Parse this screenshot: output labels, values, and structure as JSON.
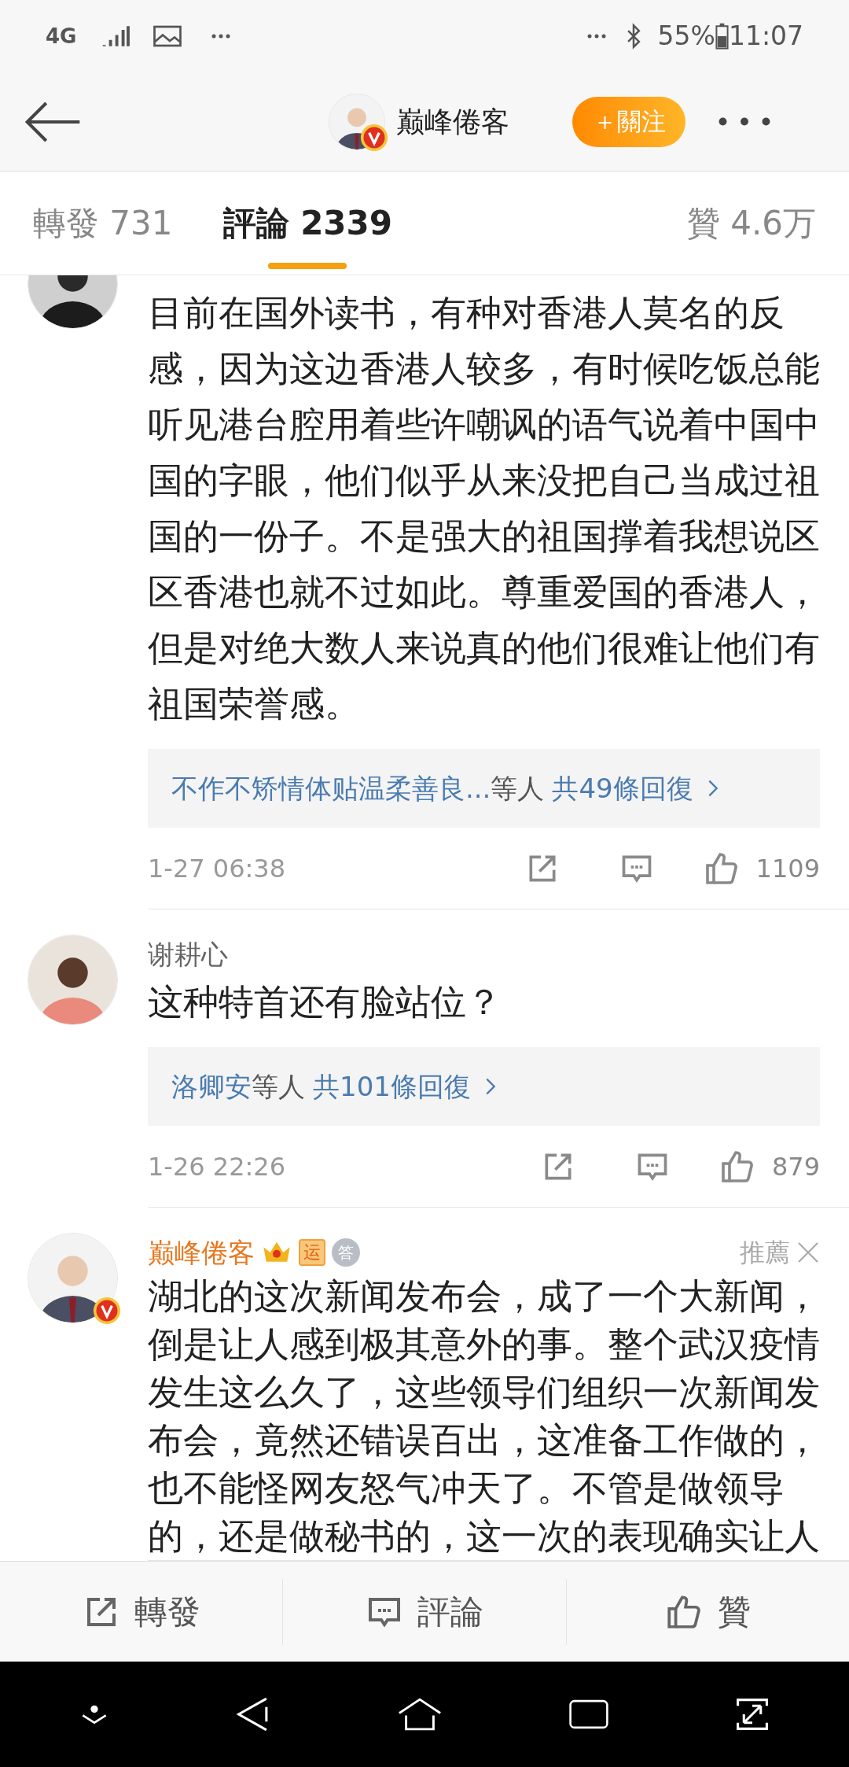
{
  "status_bar": {
    "network": "4G",
    "battery": "55%",
    "time": "11:07"
  },
  "header": {
    "name": "巅峰倦客",
    "follow": "＋關注"
  },
  "tabs": [
    {
      "label": "轉發 731",
      "selected": false
    },
    {
      "label": "評論 2339",
      "selected": true
    },
    {
      "label": "贊 4.6万",
      "selected": false
    }
  ],
  "comments": [
    {
      "text": "目前在国外读书，有种对香港人莫名的反感，因为这边香港人较多，有时候吃饭总能听见港台腔用着些许嘲讽的语气说着中国中国的字眼，他们似乎从来没把自己当成过祖国的一份子。不是强大的祖国撑着我想说区区香港也就不过如此。尊重爱国的香港人，但是对绝大数人来说真的他们很难让他们有祖国荣誉感。",
      "replies": {
        "names": "不作不矫情体贴温柔善良...",
        "middle": "等人",
        "count": "共49條回復"
      },
      "time": "1-27 06:38",
      "likes": "1109"
    },
    {
      "author": "谢耕心",
      "text": "这种特首还有脸站位？",
      "replies": {
        "names": "洛卿安",
        "middle": "等人",
        "count": "共101條回復"
      },
      "time": "1-26 22:26",
      "likes": "879"
    },
    {
      "verified": true,
      "author": "巅峰倦客",
      "highlight": true,
      "badges": [
        {
          "kind": "crown"
        },
        {
          "kind": "tag",
          "label": "运"
        },
        {
          "kind": "medal",
          "label": "答"
        }
      ],
      "recommend": "推薦",
      "text": "湖北的这次新闻发布会，成了一个大新闻，倒是让人感到极其意外的事。整个武汉疫情发生这么久了，这些领导们组织一次新闻发布会，竟然还错误百出，这准备工作做的，也不能怪网友怒气冲天了。不管是做领导的，还是做秘书的，这一次的表现确实让人"
    }
  ],
  "action_bar": [
    "轉發",
    "評論",
    "贊"
  ]
}
